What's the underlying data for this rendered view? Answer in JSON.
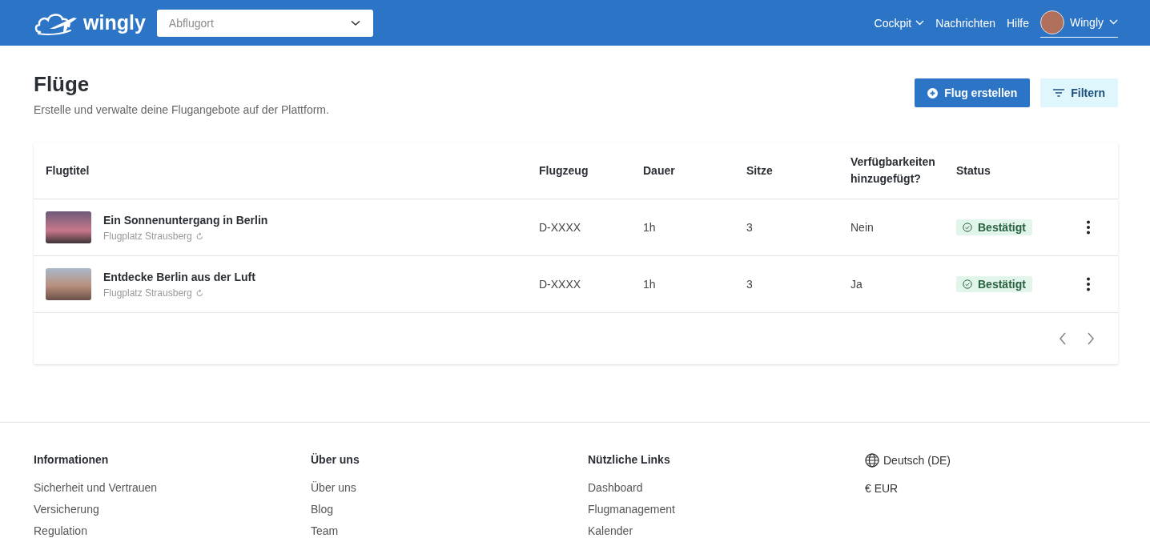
{
  "header": {
    "logo": "wingly",
    "location_select": {
      "placeholder": "Abflugort"
    },
    "nav": [
      {
        "label": "Cockpit",
        "kind": "dropdown"
      },
      {
        "label": "Nachrichten",
        "kind": "link"
      },
      {
        "label": "Hilfe",
        "kind": "link"
      },
      {
        "label": "Wingly",
        "kind": "user"
      }
    ]
  },
  "page": {
    "title": "Flüge",
    "subtitle": "Erstelle und verwalte deine Flugangebote auf der Plattform.",
    "buttons": [
      {
        "label": "Flug erstellen",
        "kind": "primary"
      },
      {
        "label": "Filtern",
        "kind": "secondary"
      }
    ]
  },
  "table": {
    "columns": [
      "Flugtitel",
      "Flugzeug",
      "Dauer",
      "Sitze",
      "Verfügbarkeiten hinzugefügt?",
      "Status"
    ],
    "rows": [
      {
        "title": "Ein Sonnenuntergang in Berlin",
        "airfield": "Flugplatz Strausberg",
        "aircraft": "D-XXXX",
        "duration": "1h",
        "seats": "3",
        "availability": "Nein",
        "status": {
          "label": "Bestätigt",
          "kind": "confirmed"
        }
      },
      {
        "title": "Entdecke Berlin aus der Luft",
        "airfield": "Flugplatz Strausberg",
        "aircraft": "D-XXXX",
        "duration": "1h",
        "seats": "3",
        "availability": "Ja",
        "status": {
          "label": "Bestätigt",
          "kind": "confirmed"
        }
      }
    ]
  },
  "footer": {
    "columns": [
      {
        "heading": "Informationen",
        "links": [
          "Sicherheit und Vertrauen",
          "Versicherung",
          "Regulation"
        ]
      },
      {
        "heading": "Über uns",
        "links": [
          "Über uns",
          "Blog",
          "Team"
        ]
      },
      {
        "heading": "Nützliche Links",
        "links": [
          "Dashboard",
          "Flugmanagement",
          "Kalender"
        ]
      }
    ],
    "language": "Deutsch (DE)",
    "currency": "€ EUR"
  }
}
